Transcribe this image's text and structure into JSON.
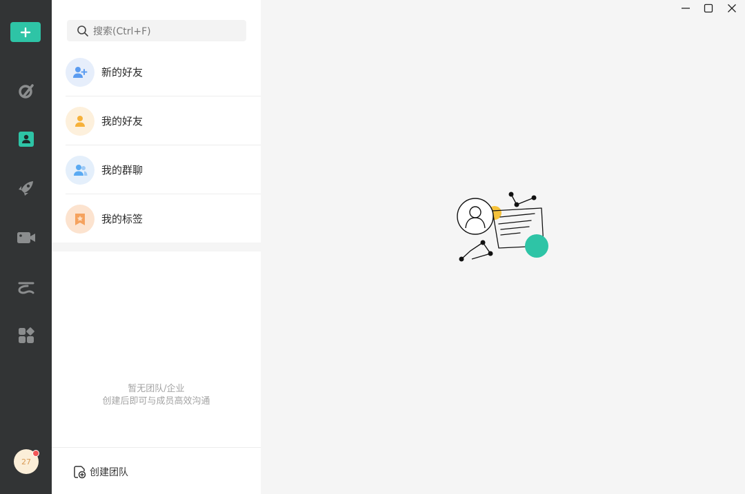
{
  "rail": {
    "add_button_icon": "plus-icon",
    "nav_icons": [
      "chat-icon",
      "contacts-icon",
      "rocket-icon",
      "video-icon",
      "cloud-icon",
      "apps-icon"
    ],
    "avatar_text": "27"
  },
  "search": {
    "placeholder": "搜索(Ctrl+F)"
  },
  "contacts": {
    "items": [
      {
        "label": "新的好友",
        "icon": "add-user-icon",
        "color": "#5b9cf0"
      },
      {
        "label": "我的好友",
        "icon": "user-icon",
        "color": "#f6b13a"
      },
      {
        "label": "我的群聊",
        "icon": "group-icon",
        "color": "#5aaaf2"
      },
      {
        "label": "我的标签",
        "icon": "bookmark-icon",
        "color": "#f5a25e"
      }
    ]
  },
  "team": {
    "empty_line1": "暂无团队/企业",
    "empty_line2": "创建后即可与成员高效沟通",
    "create_label": "创建团队"
  },
  "colors": {
    "accent": "#2ec4a6",
    "sidebar": "#323435",
    "badge": "#f25656"
  }
}
